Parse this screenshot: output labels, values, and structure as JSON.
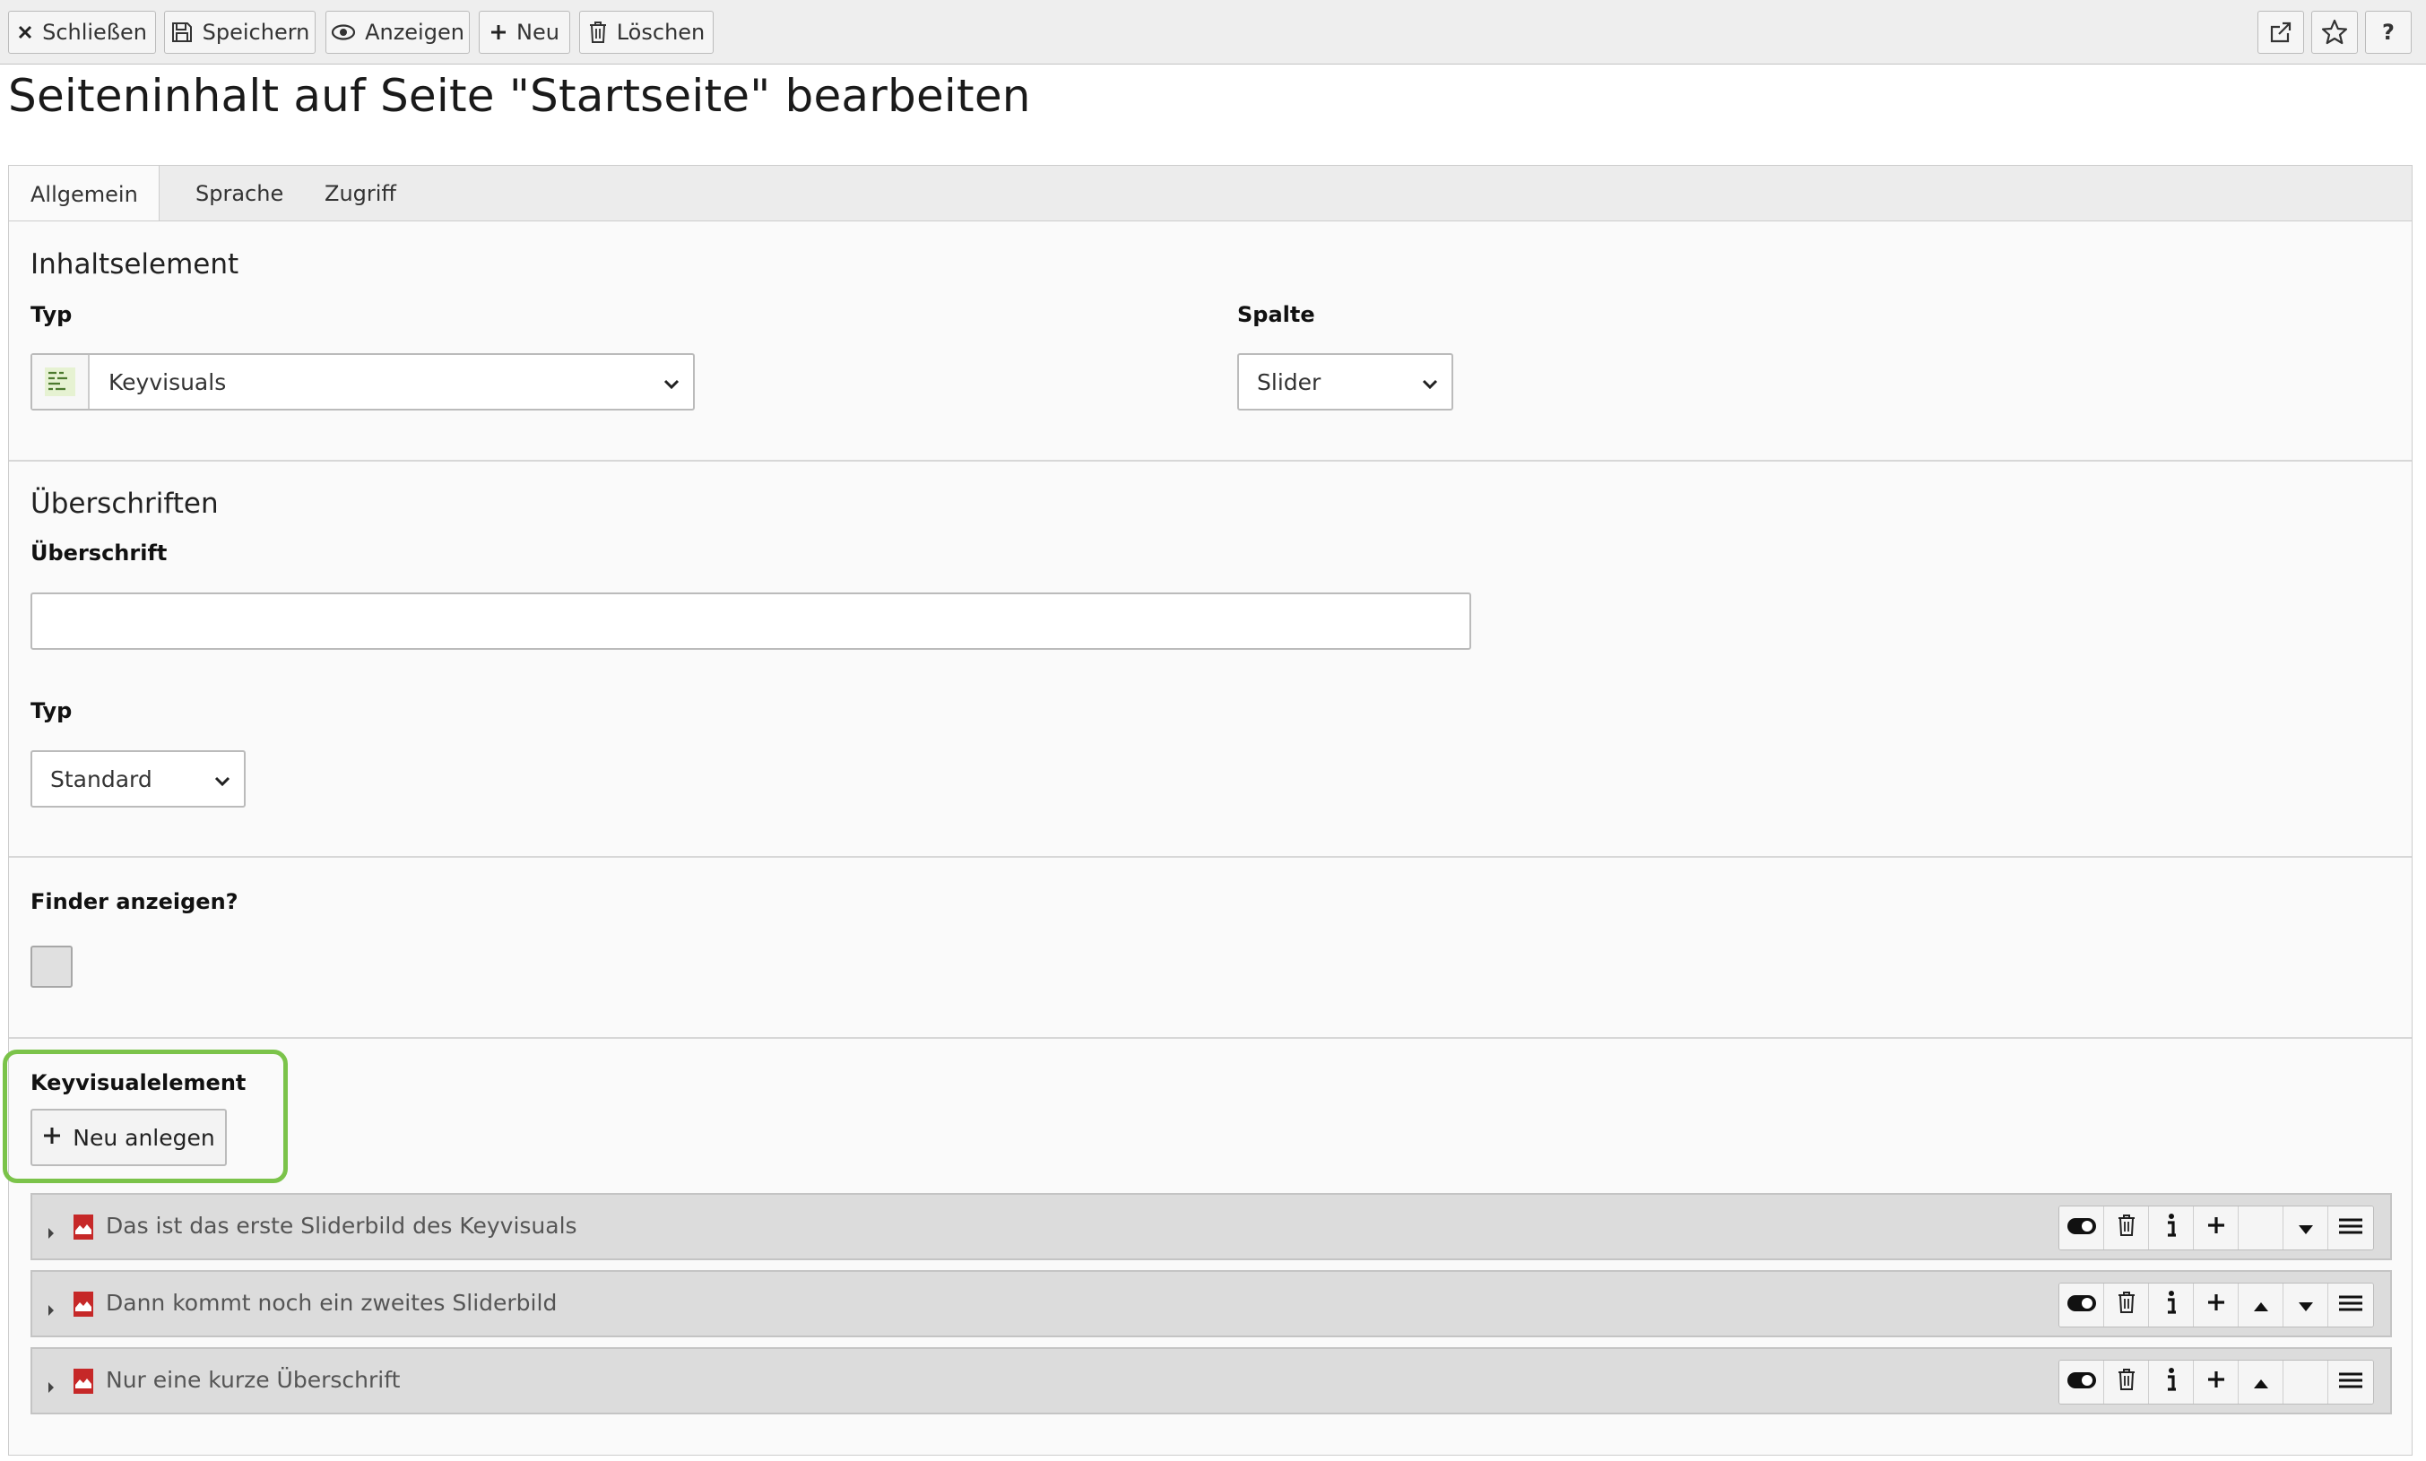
{
  "toolbar": {
    "close_label": "Schließen",
    "save_label": "Speichern",
    "view_label": "Anzeigen",
    "new_label": "Neu",
    "delete_label": "Löschen",
    "help_label": "?"
  },
  "page_title": "Seiteninhalt auf Seite \"Startseite\" bearbeiten",
  "tabs": [
    {
      "label": "Allgemein",
      "active": true
    },
    {
      "label": "Sprache",
      "active": false
    },
    {
      "label": "Zugriff",
      "active": false
    }
  ],
  "sections": {
    "content_element": {
      "title": "Inhaltselement",
      "type_label": "Typ",
      "type_value": "Keyvisuals",
      "column_label": "Spalte",
      "column_value": "Slider"
    },
    "headers": {
      "title": "Überschriften",
      "header_label": "Überschrift",
      "header_value": "",
      "header_type_label": "Typ",
      "header_type_value": "Standard"
    },
    "finder": {
      "label": "Finder anzeigen?",
      "checked": false
    },
    "keyvisual": {
      "label": "Keyvisualelement",
      "new_button_label": "Neu anlegen",
      "items": [
        {
          "title": "Das ist das erste Sliderbild des Keyvisuals",
          "can_move_up": false,
          "can_move_down": true
        },
        {
          "title": "Dann kommt noch ein zweites Sliderbild",
          "can_move_up": true,
          "can_move_down": true
        },
        {
          "title": "Nur eine kurze Überschrift",
          "can_move_up": true,
          "can_move_down": false
        }
      ]
    }
  },
  "colors": {
    "highlight": "#7bc34a",
    "record_icon": "#c62828"
  }
}
